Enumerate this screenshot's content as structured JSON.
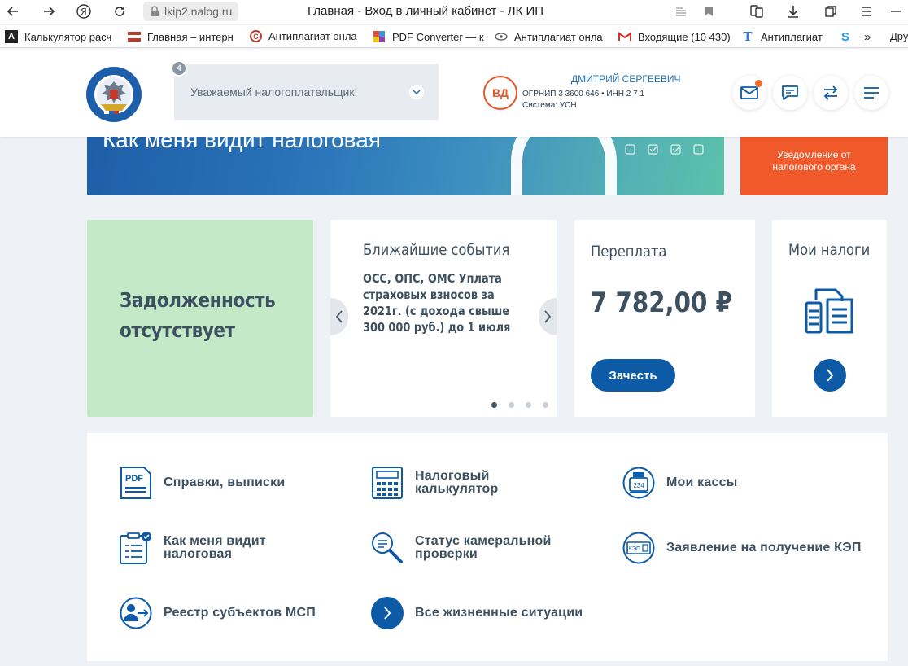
{
  "browser": {
    "address": "lkip2.nalog.ru",
    "title": "Главная - Вход в личный кабинет - ЛК ИП",
    "bookmarks": [
      {
        "label": "Калькулятор расч",
        "icon": "A"
      },
      {
        "label": "Главная – интерн",
        "icon": "flag"
      },
      {
        "label": "Антиплагиат онла",
        "icon": "C"
      },
      {
        "label": "PDF Converter — к",
        "icon": "grid"
      },
      {
        "label": "Антиплагиат онла",
        "icon": "eye"
      },
      {
        "label": "Входящие (10 430)",
        "icon": "M"
      },
      {
        "label": "Антиплагиат",
        "icon": "T"
      },
      {
        "label": "S",
        "icon": "S"
      },
      {
        "label": "»",
        "icon": ""
      },
      {
        "label": "Дру",
        "icon": ""
      }
    ]
  },
  "header": {
    "notice_count": "4",
    "notice_text": "Уважаемый налогоплательщик!",
    "avatar_initials": "ВД",
    "user_name": "ДМИТРИЙ СЕРГЕЕВИЧ",
    "user_ids": "ОГРНИП 3      3600     646  •  ИНН 2        7     1",
    "user_system": "Система: УСН"
  },
  "banner": {
    "title": "Как меня видит налоговая",
    "notification": "Уведомление от налогового органа"
  },
  "cards": {
    "debt": "Задолженность отсутствует",
    "events_title": "Ближайшие события",
    "events_text": "ОСС, ОПС, ОМС Уплата страховых взносов за 2021г. (с дохода свыше 300 000 руб.) до 1 июля",
    "overpay_title": "Переплата",
    "overpay_amount": "7 782,00 ₽",
    "overpay_button": "Зачесть",
    "taxes_title": "Мои налоги"
  },
  "services": [
    {
      "label": "Справки, выписки",
      "icon": "pdf-document-icon"
    },
    {
      "label": "Налоговый калькулятор",
      "icon": "calculator-icon"
    },
    {
      "label": "Мои кассы",
      "icon": "cash-register-icon"
    },
    {
      "label": "Как меня видит налоговая",
      "icon": "clipboard-check-icon"
    },
    {
      "label": "Статус камеральной проверки",
      "icon": "magnifier-document-icon"
    },
    {
      "label": "Заявление на получение КЭП",
      "icon": "signature-card-icon"
    },
    {
      "label": "Реестр субъектов МСП",
      "icon": "person-arrow-icon"
    },
    {
      "label": "Все жизненные ситуации",
      "icon": "chevron-right-icon"
    }
  ],
  "colors": {
    "brand_blue": "#0d5aa7",
    "accent_orange": "#f0592a",
    "debt_green": "#c4e9c7"
  }
}
